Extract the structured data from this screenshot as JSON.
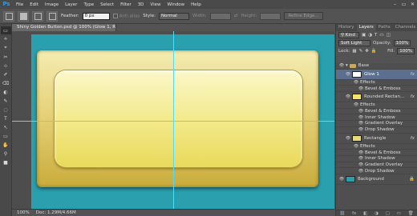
{
  "app": {
    "logo": "Ps"
  },
  "menu": [
    "File",
    "Edit",
    "Image",
    "Layer",
    "Type",
    "Select",
    "Filter",
    "3D",
    "View",
    "Window",
    "Help"
  ],
  "window_controls": [
    "–",
    "▭",
    "✕"
  ],
  "options": {
    "feather_label": "Feather:",
    "feather_value": "0 px",
    "antialias_label": "Anti-alias",
    "style_label": "Style:",
    "style_value": "Normal",
    "width_label": "Width:",
    "height_label": "Height:",
    "refine_label": "Refine Edge..."
  },
  "tools": [
    "▭",
    "⟡",
    "⌖",
    "✂",
    "⊹",
    "✐",
    "⌫",
    "◐",
    "✎",
    "◌",
    "T",
    "↖",
    "▭",
    "✋",
    "⚲",
    "■"
  ],
  "document": {
    "tab_title": "Shiny Golden Button.psd @ 100% (Glow 1, RGB/8) *"
  },
  "status": {
    "zoom": "100%",
    "doc_info": "Doc: 1.29M/4.66M"
  },
  "panel": {
    "tabs": [
      "History",
      "Layers",
      "Paths",
      "Channels"
    ],
    "kind_label": "Kind",
    "blend_mode": "Soft Light",
    "opacity_label": "Opacity:",
    "opacity_value": "100%",
    "lock_label": "Lock:",
    "fill_label": "Fill:",
    "fill_value": "100%",
    "footer_icons": [
      "⛓",
      "fx",
      "◧",
      "◑",
      "▢",
      "▭",
      "🗑"
    ]
  },
  "layers": [
    {
      "name": "Base",
      "kind": "group"
    },
    {
      "name": "Glow 1",
      "kind": "layer",
      "selected": true,
      "fx": "fx",
      "thumb_color": "#ffffff"
    },
    {
      "name": "Effects",
      "kind": "effects"
    },
    {
      "name": "Bevel & Emboss",
      "kind": "effect"
    },
    {
      "name": "Rounded Rectan...",
      "kind": "layer",
      "fx": "fx",
      "thumb_color": "#f3e36a"
    },
    {
      "name": "Effects",
      "kind": "effects"
    },
    {
      "name": "Bevel & Emboss",
      "kind": "effect"
    },
    {
      "name": "Inner Shadow",
      "kind": "effect"
    },
    {
      "name": "Gradient Overlay",
      "kind": "effect"
    },
    {
      "name": "Drop Shadow",
      "kind": "effect"
    },
    {
      "name": "Rectangle",
      "kind": "layer",
      "fx": "fx",
      "thumb_color": "#e9db7a"
    },
    {
      "name": "Effects",
      "kind": "effects"
    },
    {
      "name": "Bevel & Emboss",
      "kind": "effect"
    },
    {
      "name": "Inner Shadow",
      "kind": "effect"
    },
    {
      "name": "Gradient Overlay",
      "kind": "effect"
    },
    {
      "name": "Drop Shadow",
      "kind": "effect"
    },
    {
      "name": "Background",
      "kind": "layer",
      "thumb_color": "#2a9fad"
    }
  ]
}
